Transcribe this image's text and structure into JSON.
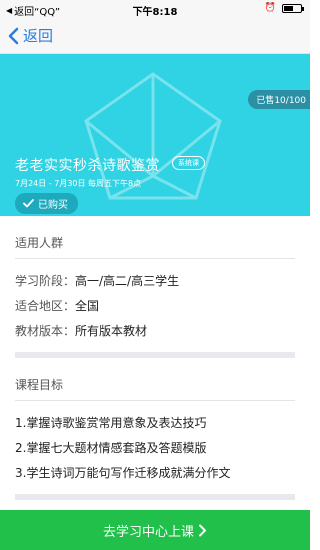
{
  "status_bar": {
    "back_app": "返回“QQ”",
    "time": "下午8:18",
    "battery_level": 0.55
  },
  "nav": {
    "back_label": "返回"
  },
  "course": {
    "sold": "已售10/100",
    "title": "老老实实秒杀诗歌鉴赏",
    "tag": "系统课",
    "schedule": "7月24日 - 7月30日 每周五下午8点",
    "status": "已购买"
  },
  "audience": {
    "heading": "适用人群",
    "rows": [
      {
        "key": "学习阶段：",
        "value": "高一/高二/高三学生"
      },
      {
        "key": "适合地区：",
        "value": "全国"
      },
      {
        "key": "教材版本：",
        "value": "所有版本教材"
      }
    ]
  },
  "goals": {
    "heading": "课程目标",
    "items": [
      "1.掌握诗歌鉴赏常用意象及表达技巧",
      "2.掌握七大题材情感套路及答题模版",
      "3.学生诗词万能句写作迁移成就满分作文"
    ]
  },
  "cta": {
    "label": "去学习中心上课"
  },
  "colors": {
    "banner": "#2fd3e4",
    "accent": "#2b7de0",
    "cta": "#21c04a"
  }
}
